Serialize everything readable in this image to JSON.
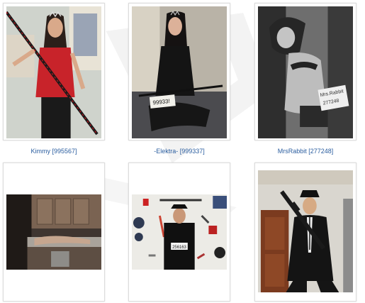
{
  "gallery": {
    "items": [
      {
        "caption": "Kimmy [995567]"
      },
      {
        "caption": "-Elektra- [999337]",
        "photo_text": "99933!"
      },
      {
        "caption": "MrsRabbit [277248]",
        "photo_text": "Mrs.Rabbit\n277248"
      },
      {
        "caption": ""
      },
      {
        "caption": "",
        "photo_text": "256163"
      },
      {
        "caption": ""
      }
    ]
  },
  "colors": {
    "caption_link": "#2a5d9f",
    "card_border": "#dcdcdc"
  }
}
